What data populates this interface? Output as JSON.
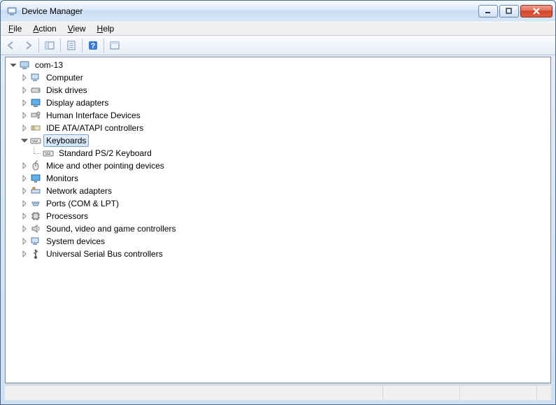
{
  "window": {
    "title": "Device Manager"
  },
  "menu": {
    "file": "File",
    "action": "Action",
    "view": "View",
    "help": "Help"
  },
  "tree": {
    "root": "com-13",
    "nodes": {
      "computer": "Computer",
      "disk_drives": "Disk drives",
      "display_adapters": "Display adapters",
      "hid": "Human Interface Devices",
      "ide": "IDE ATA/ATAPI controllers",
      "keyboards": "Keyboards",
      "keyboard_child": "Standard PS/2 Keyboard",
      "mice": "Mice and other pointing devices",
      "monitors": "Monitors",
      "network": "Network adapters",
      "ports": "Ports (COM & LPT)",
      "processors": "Processors",
      "sound": "Sound, video and game controllers",
      "system": "System devices",
      "usb": "Universal Serial Bus controllers"
    }
  },
  "colors": {
    "selection_border": "#7da2ce",
    "close_red": "#cf4326"
  }
}
